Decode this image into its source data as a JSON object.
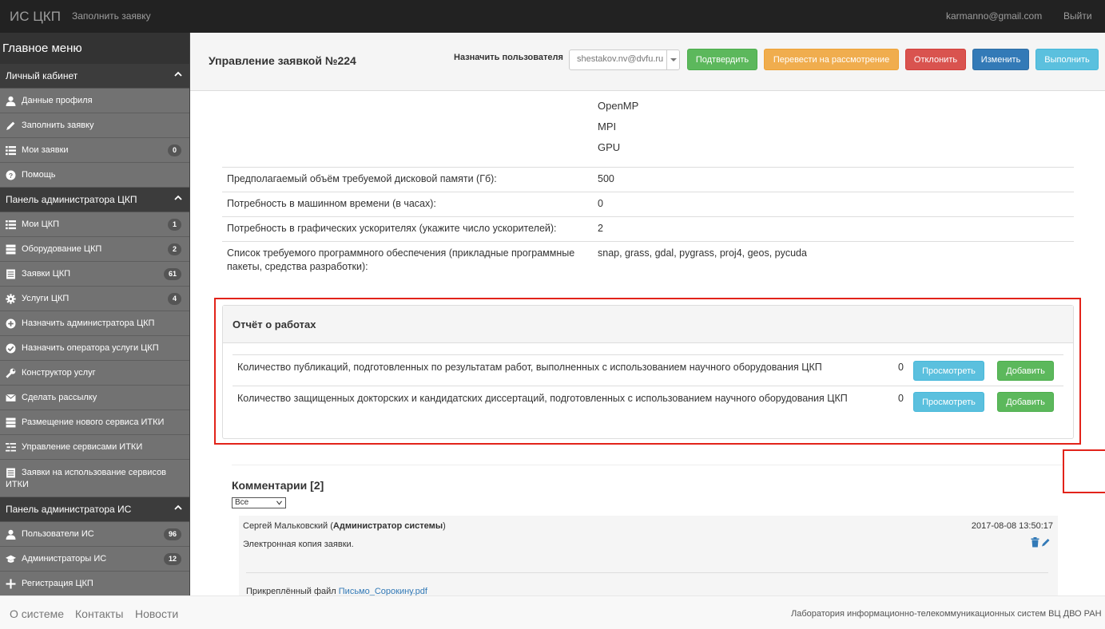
{
  "navbar": {
    "brand": "ИС ЦКП",
    "fill_request": "Заполнить заявку",
    "email": "karmanno@gmail.com",
    "logout": "Выйти"
  },
  "sidebar": {
    "title": "Главное меню",
    "sections": {
      "personal": "Личный кабинет",
      "ckp_admin": "Панель администратора ЦКП",
      "is_admin": "Панель администратора ИС"
    },
    "items": {
      "profile": "Данные профиля",
      "fill": "Заполнить заявку",
      "my_requests": "Мои заявки",
      "my_requests_count": "0",
      "help": "Помощь",
      "my_ckp": "Мои ЦКП",
      "my_ckp_count": "1",
      "equipment": "Оборудование ЦКП",
      "equipment_count": "2",
      "requests": "Заявки ЦКП",
      "requests_count": "61",
      "services": "Услуги ЦКП",
      "services_count": "4",
      "assign_admin": "Назначить администратора ЦКП",
      "assign_operator": "Назначить оператора услуги ЦКП",
      "constructor": "Конструктор услуг",
      "mailing": "Сделать рассылку",
      "new_service": "Размещение нового сервиса ИТКИ",
      "manage_services": "Управление сервисами ИТКИ",
      "service_requests": "Заявки на использование сервисов ИТКИ",
      "users": "Пользователи ИС",
      "users_count": "96",
      "admins": "Администраторы ИС",
      "admins_count": "12",
      "register": "Регистрация ЦКП"
    }
  },
  "header": {
    "title": "Управление заявкой №224",
    "assign_label": "Назначить пользователя",
    "assign_value": "shestakov.nv@dvfu.ru",
    "confirm": "Подтвердить",
    "review": "Перевести на рассмотрение",
    "reject": "Отклонить",
    "change": "Изменить",
    "execute": "Выполнить"
  },
  "details": {
    "tech_list": [
      "OpenMP",
      "MPI",
      "GPU"
    ],
    "rows": [
      {
        "label": "Предполагаемый объём требуемой дисковой памяти (Гб):",
        "value": "500"
      },
      {
        "label": "Потребность в машинном времени (в часах):",
        "value": "0"
      },
      {
        "label": "Потребность в графических ускорителях (укажите число ускорителей):",
        "value": "2"
      },
      {
        "label": "Список требуемого программного обеспечения (прикладные программные пакеты, средства разработки):",
        "value": "snap, grass, gdal, pygrass, proj4, geos, pycuda"
      }
    ]
  },
  "report": {
    "title": "Отчёт о работах",
    "view": "Просмотреть",
    "add": "Добавить",
    "rows": [
      {
        "text": "Количество публикаций, подготовленных по результатам работ, выполненных с использованием научного оборудования ЦКП",
        "count": "0"
      },
      {
        "text": "Количество защищенных докторских и кандидатских диссертаций, подготовленных с использованием научного оборудования ЦКП",
        "count": "0"
      }
    ]
  },
  "comments": {
    "title": "Комментарии [2]",
    "filter": "Все",
    "items": [
      {
        "author": "Сергей Мальковский (",
        "role": "Администратор системы",
        "author_end": ")",
        "date": "2017-08-08 13:50:17",
        "text": "Электронная копия заявки.",
        "attach_label": "Прикреплённый файл ",
        "attach_file": "Письмо_Сорокину.pdf"
      }
    ]
  },
  "footer": {
    "about": "О системе",
    "contacts": "Контакты",
    "news": "Новости",
    "lab": "Лаборатория информационно-телекоммуникационных систем ВЦ ДВО РАН"
  }
}
